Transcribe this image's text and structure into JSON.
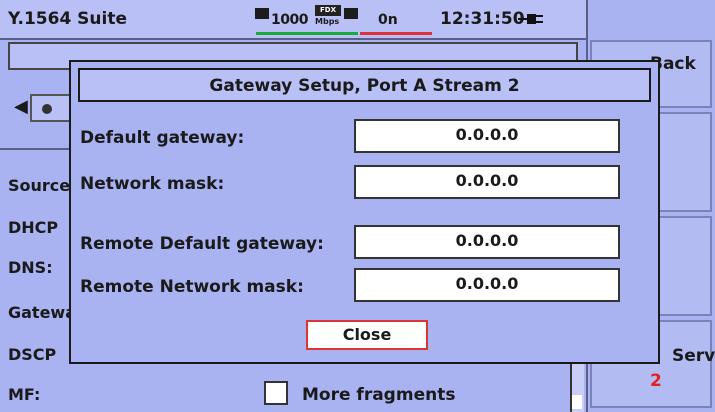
{
  "status_bar": {
    "app_title": "Y.1564 Suite",
    "speed": "1000",
    "duplex": "FDX",
    "speed_unit": "Mbps",
    "count": "0n",
    "clock": "12:31:50",
    "icons": [
      "ethernet-port-icon",
      "ethernet-port-icon",
      "power-plug-icon"
    ],
    "colors": {
      "link_green": "#1aaa3a",
      "link_red": "#e0303a"
    }
  },
  "softkeys": {
    "back_label": "Back",
    "service_label": "Service",
    "service_number": "2"
  },
  "background": {
    "labels": [
      "Source",
      "DHCP",
      "DNS:",
      "Gateway",
      "DSCP",
      "MF:"
    ],
    "mf_checkbox_label": "More fragments",
    "mf_checked": false
  },
  "dialog": {
    "title": "Gateway Setup, Port A Stream 2",
    "fields": [
      {
        "label": "Default gateway:",
        "value": "0.0.0.0"
      },
      {
        "label": "Network mask:",
        "value": "0.0.0.0"
      },
      {
        "label": "Remote Default gateway:",
        "value": "0.0.0.0"
      },
      {
        "label": "Remote Network mask:",
        "value": "0.0.0.0"
      }
    ],
    "close_label": "Close"
  }
}
